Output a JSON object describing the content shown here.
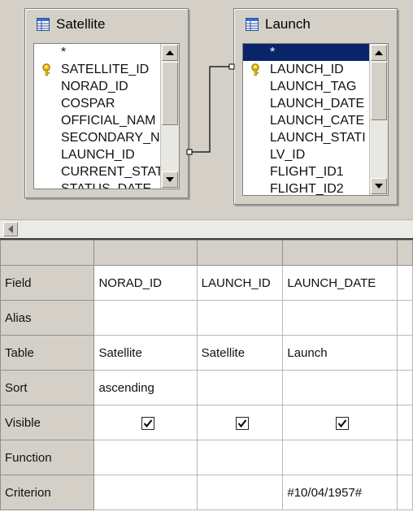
{
  "design_tables": [
    {
      "title": "Satellite",
      "fields": [
        {
          "label": "*",
          "key": false,
          "selected": false
        },
        {
          "label": "SATELLITE_ID",
          "key": true,
          "selected": false
        },
        {
          "label": "NORAD_ID",
          "key": false,
          "selected": false
        },
        {
          "label": "COSPAR",
          "key": false,
          "selected": false
        },
        {
          "label": "OFFICIAL_NAM",
          "key": false,
          "selected": false
        },
        {
          "label": "SECONDARY_N",
          "key": false,
          "selected": false
        },
        {
          "label": "LAUNCH_ID",
          "key": false,
          "selected": false
        },
        {
          "label": "CURRENT_STAT",
          "key": false,
          "selected": false
        },
        {
          "label": "STATUS_DATE",
          "key": false,
          "selected": false
        }
      ]
    },
    {
      "title": "Launch",
      "fields": [
        {
          "label": "*",
          "key": false,
          "selected": true
        },
        {
          "label": "LAUNCH_ID",
          "key": true,
          "selected": false
        },
        {
          "label": "LAUNCH_TAG",
          "key": false,
          "selected": false
        },
        {
          "label": "LAUNCH_DATE",
          "key": false,
          "selected": false
        },
        {
          "label": "LAUNCH_CATE",
          "key": false,
          "selected": false
        },
        {
          "label": "LAUNCH_STATI",
          "key": false,
          "selected": false
        },
        {
          "label": "LV_ID",
          "key": false,
          "selected": false
        },
        {
          "label": "FLIGHT_ID1",
          "key": false,
          "selected": false
        },
        {
          "label": "FLIGHT_ID2",
          "key": false,
          "selected": false
        }
      ]
    }
  ],
  "query_grid": {
    "row_labels": {
      "field": "Field",
      "alias": "Alias",
      "table": "Table",
      "sort": "Sort",
      "visible": "Visible",
      "function": "Function",
      "criterion": "Criterion"
    },
    "columns": [
      {
        "field": "NORAD_ID",
        "alias": "",
        "table": "Satellite",
        "sort": "ascending",
        "visible": true,
        "function": "",
        "criterion": ""
      },
      {
        "field": "LAUNCH_ID",
        "alias": "",
        "table": "Satellite",
        "sort": "",
        "visible": true,
        "function": "",
        "criterion": ""
      },
      {
        "field": "LAUNCH_DATE",
        "alias": "",
        "table": "Launch",
        "sort": "",
        "visible": true,
        "function": "",
        "criterion": "#10/04/1957#"
      },
      {
        "field": "",
        "alias": "",
        "table": "",
        "sort": "",
        "visible": false,
        "function": "",
        "criterion": ""
      }
    ]
  },
  "colors": {
    "selection": "#0a246a",
    "key_icon": "#e0a800",
    "chrome": "#d4d0c8"
  }
}
